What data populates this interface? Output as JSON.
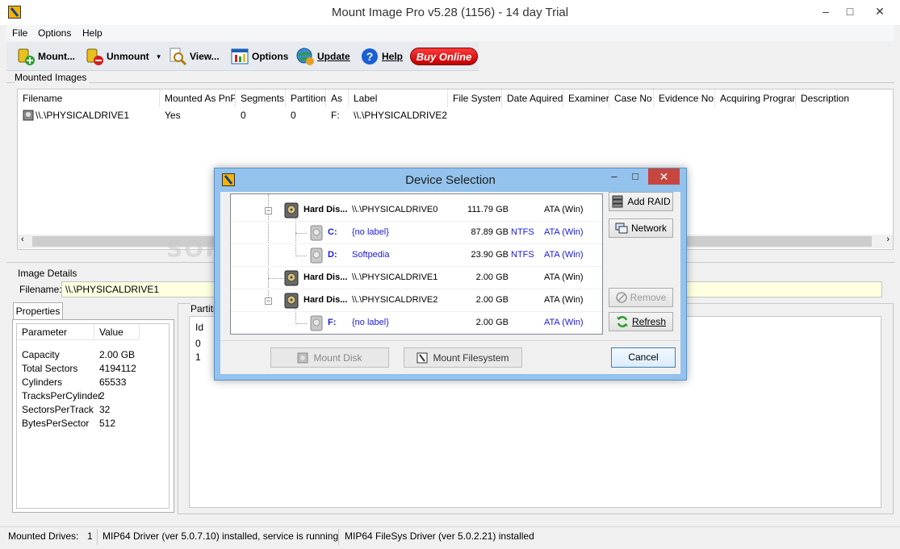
{
  "window": {
    "title": "Mount Image Pro v5.28 (1156) - 14 day Trial",
    "min": "–",
    "max": "□",
    "close": "✕"
  },
  "menu": [
    "File",
    "Options",
    "Help"
  ],
  "toolbar": {
    "mount": "Mount...",
    "unmount": "Unmount",
    "view": "View...",
    "options": "Options",
    "update": "Update",
    "help": "Help",
    "buy": "Buy Online"
  },
  "mounted": {
    "group_label": "Mounted Images",
    "columns": [
      "Filename",
      "Mounted As PnP",
      "Segments",
      "Partition",
      "As",
      "Label",
      "File System",
      "Date Aquired",
      "Examiner",
      "Case No",
      "Evidence No",
      "Acquiring Program",
      "Description"
    ],
    "row": {
      "filename": "\\\\.\\PHYSICALDRIVE1",
      "pnp": "Yes",
      "segments": "0",
      "partition": "0",
      "as": "F:",
      "label": "\\\\.\\PHYSICALDRIVE2"
    }
  },
  "details": {
    "group_label": "Image Details",
    "filename_label": "Filename:",
    "filename_value": "\\\\.\\PHYSICALDRIVE1",
    "properties_tab": "Properties",
    "prop_header": [
      "Parameter",
      "Value"
    ],
    "props": [
      {
        "k": "Capacity",
        "v": "2.00 GB"
      },
      {
        "k": "Total Sectors",
        "v": "4194112"
      },
      {
        "k": "Cylinders",
        "v": "65533"
      },
      {
        "k": "TracksPerCylinder",
        "v": "2"
      },
      {
        "k": "SectorsPerTrack",
        "v": "32"
      },
      {
        "k": "BytesPerSector",
        "v": "512"
      }
    ],
    "partitions_label": "Partiti",
    "part_header": "Id",
    "part_ids": [
      "0",
      "1"
    ]
  },
  "status": {
    "drives_label": "Mounted Drives:",
    "drives_count": "1",
    "driver": "MIP64 Driver (ver 5.0.7.10) installed, service is running",
    "filesys": "MIP64 FileSys Driver (ver 5.0.2.21) installed"
  },
  "watermark": "SOFTPEDIA",
  "dialog": {
    "title": "Device Selection",
    "min": "–",
    "max": "□",
    "close": "✕",
    "rows": [
      {
        "name": "Hard Dis...",
        "path": "\\\\.\\PHYSICALDRIVE0",
        "size": "111.79 GB",
        "fs": "",
        "bus": "ATA (Win)"
      },
      {
        "name": "C:",
        "path": "{no label}",
        "size": "87.89 GB",
        "fs": "NTFS",
        "bus": "ATA (Win)"
      },
      {
        "name": "D:",
        "path": "Softpedia",
        "size": "23.90 GB",
        "fs": "NTFS",
        "bus": "ATA (Win)"
      },
      {
        "name": "Hard Dis...",
        "path": "\\\\.\\PHYSICALDRIVE1",
        "size": "2.00 GB",
        "fs": "",
        "bus": "ATA (Win)"
      },
      {
        "name": "Hard Dis...",
        "path": "\\\\.\\PHYSICALDRIVE2",
        "size": "2.00 GB",
        "fs": "",
        "bus": "ATA (Win)"
      },
      {
        "name": "F:",
        "path": "{no label}",
        "size": "2.00 GB",
        "fs": "",
        "bus": "ATA (Win)"
      }
    ],
    "add_raid": "Add RAID",
    "network": "Network",
    "remove": "Remove",
    "refresh": "Refresh",
    "mount_disk": "Mount Disk",
    "mount_fs": "Mount Filesystem",
    "cancel": "Cancel"
  },
  "colors": {
    "dialog_frame": "#93c2ec",
    "close_red": "#c7463f",
    "link_blue": "#1a1adb",
    "buy_red": "#e00000"
  }
}
